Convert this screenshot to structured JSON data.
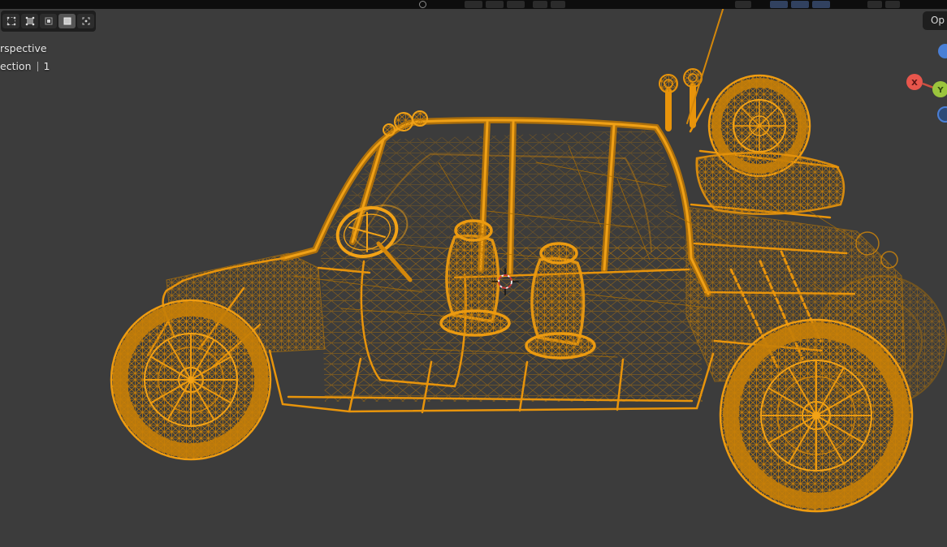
{
  "colors": {
    "viewport_bg": "#3c3c3c",
    "topbar_bg": "#0d0d0d",
    "panel_bg": "#1e1e1e",
    "wireframe_orange": "#e8940b",
    "wireframe_bright": "#f2a216",
    "wireframe_dim": "#b57507",
    "axis_x_red": "#e8564c",
    "axis_y_green": "#9bc53d",
    "axis_z_blue": "#4a7fd6",
    "overlay_text": "#e8e8e8"
  },
  "topbar": {
    "icon_names": [
      "mode-dropdown-icon",
      "tool-settings-icon",
      "orientation-icon",
      "pivot-icon",
      "snap-magnet-icon",
      "proportional-edit-icon",
      "overlays-icon",
      "gizmos-icon",
      "shading-icons"
    ]
  },
  "viewport": {
    "header": {
      "options_button_label": "Op",
      "select_mode_icons": [
        "select-mode-icon-1",
        "select-mode-icon-2",
        "select-mode-icon-3",
        "select-mode-icon-4",
        "select-mode-icon-5"
      ],
      "select_mode_active_index": 3
    },
    "overlay_text": {
      "perspective": "rspective",
      "collection": "ection",
      "collection_number": "1"
    },
    "gizmo": {
      "axis_x_label": "X",
      "axis_y_label": "Y"
    },
    "scene_description": "Orange wireframe 3D model of a four-seat off-road buggy (side view) with spare tire on rear rack, shown in edit/wireframe mode with 3D cursor"
  }
}
